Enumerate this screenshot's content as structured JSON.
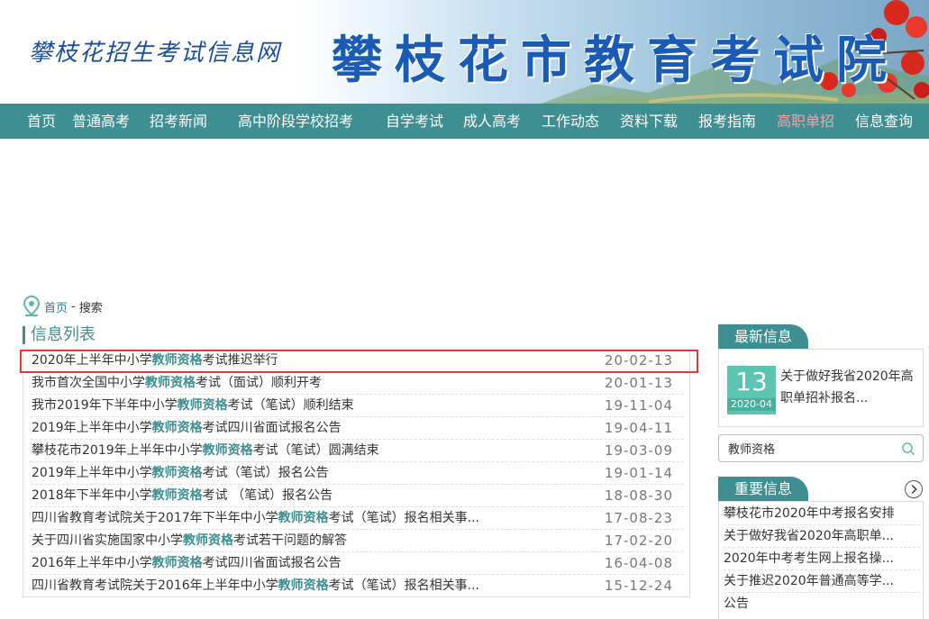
{
  "header": {
    "subtitle": "攀枝花招生考试信息网",
    "title": "攀枝花市教育考试院"
  },
  "nav": {
    "items": [
      {
        "label": "首页"
      },
      {
        "label": "普通高考"
      },
      {
        "label": "招考新闻"
      },
      {
        "label": "高中阶段学校招考"
      },
      {
        "label": "自学考试"
      },
      {
        "label": "成人高考"
      },
      {
        "label": "工作动态"
      },
      {
        "label": "资料下载"
      },
      {
        "label": "报考指南"
      },
      {
        "label": "高职单招",
        "active": true
      },
      {
        "label": "信息查询"
      }
    ],
    "bg_color": "#3d8f91",
    "active_color": "#f4a3a8"
  },
  "breadcrumb": {
    "icon": "location-pin-icon",
    "home": "首页",
    "separator": "-",
    "current": "搜索"
  },
  "list": {
    "title": "信息列表",
    "keyword": "教师资格",
    "items": [
      {
        "pre": "2020年上半年中小学",
        "kw": "教师资格",
        "post": "考试推迟举行",
        "date": "20-02-13",
        "highlighted": true
      },
      {
        "pre": "我市首次全国中小学",
        "kw": "教师资格",
        "post": "考试（面试）顺利开考",
        "date": "20-01-13"
      },
      {
        "pre": "我市2019年下半年中小学",
        "kw": "教师资格",
        "post": "考试（笔试）顺利结束",
        "date": "19-11-04"
      },
      {
        "pre": "2019年上半年中小学",
        "kw": "教师资格",
        "post": "考试四川省面试报名公告",
        "date": "19-04-11"
      },
      {
        "pre": "攀枝花市2019年上半年中小学",
        "kw": "教师资格",
        "post": "考试（笔试）圆满结束",
        "date": "19-03-09"
      },
      {
        "pre": "2019年上半年中小学",
        "kw": "教师资格",
        "post": "考试（笔试）报名公告",
        "date": "19-01-14"
      },
      {
        "pre": "2018年下半年中小学",
        "kw": "教师资格",
        "post": "考试 （笔试）报名公告",
        "date": "18-08-30"
      },
      {
        "pre": "四川省教育考试院关于2017年下半年中小学",
        "kw": "教师资格",
        "post": "考试（笔试）报名相关事...",
        "date": "17-08-23"
      },
      {
        "pre": "关于四川省实施国家中小学",
        "kw": "教师资格",
        "post": "考试若干问题的解答",
        "date": "17-02-20"
      },
      {
        "pre": "2016年上半年中小学",
        "kw": "教师资格",
        "post": "考试四川省面试报名公告",
        "date": "16-04-08"
      },
      {
        "pre": "四川省教育考试院关于2016年上半年中小学",
        "kw": "教师资格",
        "post": "考试（笔试）报名相关事...",
        "date": "15-12-24"
      }
    ]
  },
  "latest": {
    "title": "最新信息",
    "day": "13",
    "month": "2020-04",
    "text": "关于做好我省2020年高职单招补报名..."
  },
  "search": {
    "value": "教师资格",
    "icon": "search-icon"
  },
  "important": {
    "title": "重要信息",
    "more_icon": "chevron-right-circle-icon",
    "items": [
      {
        "label": "攀枝花市2020年中考报名安排"
      },
      {
        "label": "关于做好我省2020年高职单..."
      },
      {
        "label": "2020年中考考生网上报名操..."
      },
      {
        "label": "关于推迟2020年普通高等学..."
      },
      {
        "label": "公告"
      }
    ]
  }
}
